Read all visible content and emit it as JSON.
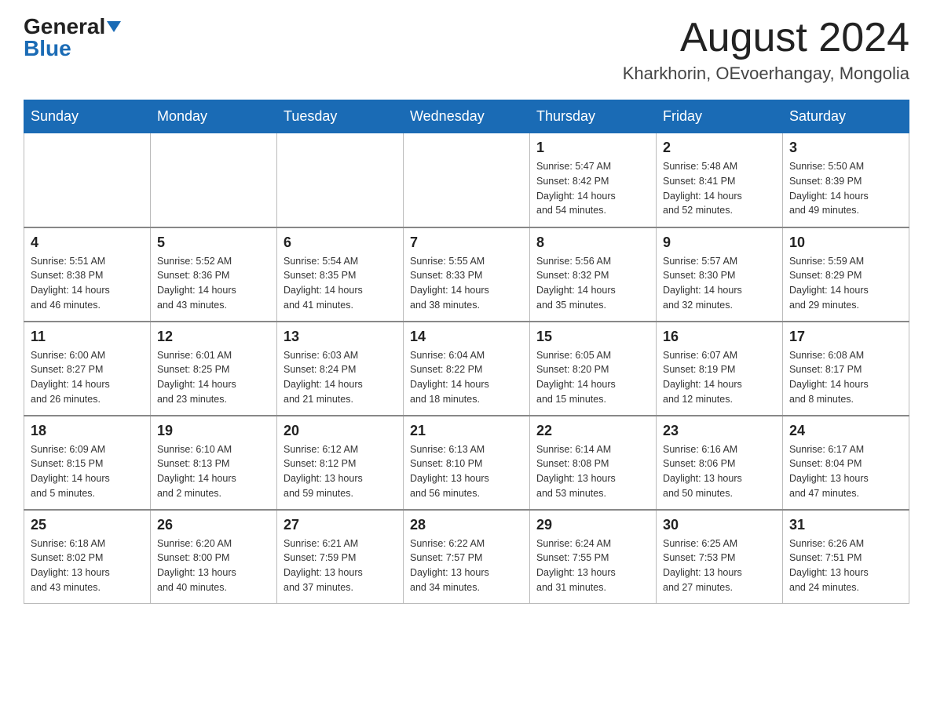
{
  "header": {
    "logo_general": "General",
    "logo_blue": "Blue",
    "month_title": "August 2024",
    "location": "Kharkhorin, OEvoerhangay, Mongolia"
  },
  "weekdays": [
    "Sunday",
    "Monday",
    "Tuesday",
    "Wednesday",
    "Thursday",
    "Friday",
    "Saturday"
  ],
  "weeks": [
    [
      {
        "day": "",
        "info": ""
      },
      {
        "day": "",
        "info": ""
      },
      {
        "day": "",
        "info": ""
      },
      {
        "day": "",
        "info": ""
      },
      {
        "day": "1",
        "info": "Sunrise: 5:47 AM\nSunset: 8:42 PM\nDaylight: 14 hours\nand 54 minutes."
      },
      {
        "day": "2",
        "info": "Sunrise: 5:48 AM\nSunset: 8:41 PM\nDaylight: 14 hours\nand 52 minutes."
      },
      {
        "day": "3",
        "info": "Sunrise: 5:50 AM\nSunset: 8:39 PM\nDaylight: 14 hours\nand 49 minutes."
      }
    ],
    [
      {
        "day": "4",
        "info": "Sunrise: 5:51 AM\nSunset: 8:38 PM\nDaylight: 14 hours\nand 46 minutes."
      },
      {
        "day": "5",
        "info": "Sunrise: 5:52 AM\nSunset: 8:36 PM\nDaylight: 14 hours\nand 43 minutes."
      },
      {
        "day": "6",
        "info": "Sunrise: 5:54 AM\nSunset: 8:35 PM\nDaylight: 14 hours\nand 41 minutes."
      },
      {
        "day": "7",
        "info": "Sunrise: 5:55 AM\nSunset: 8:33 PM\nDaylight: 14 hours\nand 38 minutes."
      },
      {
        "day": "8",
        "info": "Sunrise: 5:56 AM\nSunset: 8:32 PM\nDaylight: 14 hours\nand 35 minutes."
      },
      {
        "day": "9",
        "info": "Sunrise: 5:57 AM\nSunset: 8:30 PM\nDaylight: 14 hours\nand 32 minutes."
      },
      {
        "day": "10",
        "info": "Sunrise: 5:59 AM\nSunset: 8:29 PM\nDaylight: 14 hours\nand 29 minutes."
      }
    ],
    [
      {
        "day": "11",
        "info": "Sunrise: 6:00 AM\nSunset: 8:27 PM\nDaylight: 14 hours\nand 26 minutes."
      },
      {
        "day": "12",
        "info": "Sunrise: 6:01 AM\nSunset: 8:25 PM\nDaylight: 14 hours\nand 23 minutes."
      },
      {
        "day": "13",
        "info": "Sunrise: 6:03 AM\nSunset: 8:24 PM\nDaylight: 14 hours\nand 21 minutes."
      },
      {
        "day": "14",
        "info": "Sunrise: 6:04 AM\nSunset: 8:22 PM\nDaylight: 14 hours\nand 18 minutes."
      },
      {
        "day": "15",
        "info": "Sunrise: 6:05 AM\nSunset: 8:20 PM\nDaylight: 14 hours\nand 15 minutes."
      },
      {
        "day": "16",
        "info": "Sunrise: 6:07 AM\nSunset: 8:19 PM\nDaylight: 14 hours\nand 12 minutes."
      },
      {
        "day": "17",
        "info": "Sunrise: 6:08 AM\nSunset: 8:17 PM\nDaylight: 14 hours\nand 8 minutes."
      }
    ],
    [
      {
        "day": "18",
        "info": "Sunrise: 6:09 AM\nSunset: 8:15 PM\nDaylight: 14 hours\nand 5 minutes."
      },
      {
        "day": "19",
        "info": "Sunrise: 6:10 AM\nSunset: 8:13 PM\nDaylight: 14 hours\nand 2 minutes."
      },
      {
        "day": "20",
        "info": "Sunrise: 6:12 AM\nSunset: 8:12 PM\nDaylight: 13 hours\nand 59 minutes."
      },
      {
        "day": "21",
        "info": "Sunrise: 6:13 AM\nSunset: 8:10 PM\nDaylight: 13 hours\nand 56 minutes."
      },
      {
        "day": "22",
        "info": "Sunrise: 6:14 AM\nSunset: 8:08 PM\nDaylight: 13 hours\nand 53 minutes."
      },
      {
        "day": "23",
        "info": "Sunrise: 6:16 AM\nSunset: 8:06 PM\nDaylight: 13 hours\nand 50 minutes."
      },
      {
        "day": "24",
        "info": "Sunrise: 6:17 AM\nSunset: 8:04 PM\nDaylight: 13 hours\nand 47 minutes."
      }
    ],
    [
      {
        "day": "25",
        "info": "Sunrise: 6:18 AM\nSunset: 8:02 PM\nDaylight: 13 hours\nand 43 minutes."
      },
      {
        "day": "26",
        "info": "Sunrise: 6:20 AM\nSunset: 8:00 PM\nDaylight: 13 hours\nand 40 minutes."
      },
      {
        "day": "27",
        "info": "Sunrise: 6:21 AM\nSunset: 7:59 PM\nDaylight: 13 hours\nand 37 minutes."
      },
      {
        "day": "28",
        "info": "Sunrise: 6:22 AM\nSunset: 7:57 PM\nDaylight: 13 hours\nand 34 minutes."
      },
      {
        "day": "29",
        "info": "Sunrise: 6:24 AM\nSunset: 7:55 PM\nDaylight: 13 hours\nand 31 minutes."
      },
      {
        "day": "30",
        "info": "Sunrise: 6:25 AM\nSunset: 7:53 PM\nDaylight: 13 hours\nand 27 minutes."
      },
      {
        "day": "31",
        "info": "Sunrise: 6:26 AM\nSunset: 7:51 PM\nDaylight: 13 hours\nand 24 minutes."
      }
    ]
  ]
}
